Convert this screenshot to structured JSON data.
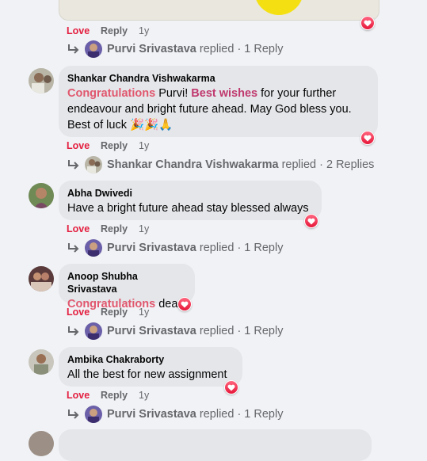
{
  "comments": [
    {
      "author": "",
      "actions": {
        "love": "Love",
        "reply": "Reply",
        "time": "1y"
      },
      "replies": {
        "name": "Purvi Srivastava",
        "text": "replied · 1 Reply"
      }
    },
    {
      "author": "Shankar Chandra Vishwakarma",
      "text_parts": [
        "Congratulations",
        " Purvi! ",
        "Best wishes",
        " for your further",
        "endeavour and bright future ahead. May God bless you.",
        "Best of luck 🎉🎉🙏"
      ],
      "actions": {
        "love": "Love",
        "reply": "Reply",
        "time": "1y"
      },
      "replies": {
        "name": "Shankar Chandra Vishwakarma",
        "text": "replied · 2 Replies"
      }
    },
    {
      "author": "Abha Dwivedi",
      "text": "Have a bright future ahead stay blessed always",
      "actions": {
        "love": "Love",
        "reply": "Reply",
        "time": "1y"
      },
      "replies": {
        "name": "Purvi Srivastava",
        "text": "replied · 1 Reply"
      }
    },
    {
      "author": "Anoop Shubha Srivastava",
      "text_parts": [
        "Congratulations",
        " dear"
      ],
      "actions": {
        "love": "Love",
        "reply": "Reply",
        "time": "1y"
      },
      "replies": {
        "name": "Purvi Srivastava",
        "text": "replied · 1 Reply"
      }
    },
    {
      "author": "Ambika Chakraborty",
      "text": "All the best for new assignment",
      "actions": {
        "love": "Love",
        "reply": "Reply",
        "time": "1y"
      },
      "replies": {
        "name": "Purvi Srivastava",
        "text": "replied · 1 Reply"
      }
    }
  ],
  "icons": {
    "reaction": "heart-icon",
    "reply_arrow": "reply-arrow-icon"
  },
  "colors": {
    "love": "#e41e3f",
    "highlight": "#e1576e",
    "bubble": "#e4e6e9",
    "background": "#f0f2f5"
  }
}
